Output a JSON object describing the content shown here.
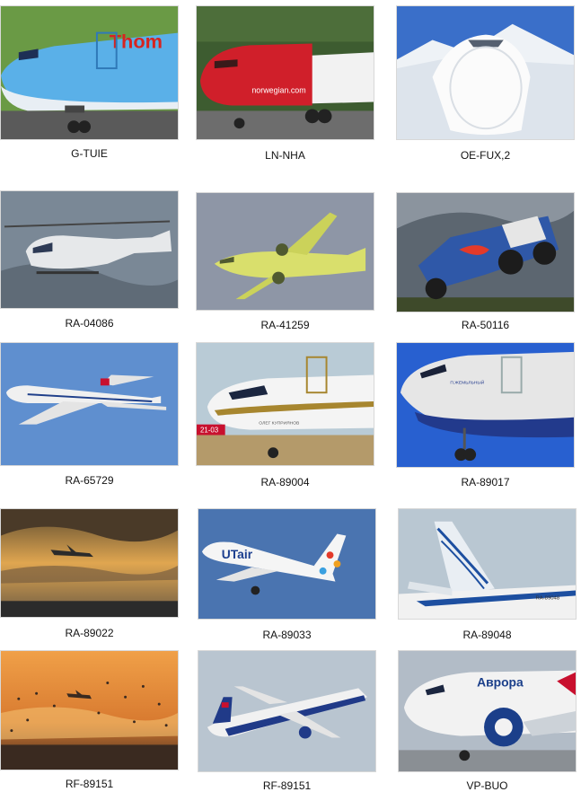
{
  "gallery": {
    "items": [
      {
        "label": "G-TUIE",
        "subject": "boeing-787-airliner",
        "livery_text": "Thom",
        "colors": {
          "sky": "#6a9a45",
          "body": "#5ab0e8",
          "accent": "#d8231f"
        }
      },
      {
        "label": "LN-NHA",
        "subject": "boeing-737-airliner",
        "livery_text": "norwegian.com",
        "colors": {
          "sky": "#3d5c30",
          "body": "#f2f2f2",
          "accent": "#d01f2a"
        }
      },
      {
        "label": "OE-FUX,2",
        "subject": "business-jet-nose-snow",
        "colors": {
          "sky": "#3a6fc9",
          "body": "#eef2f6",
          "accent": "#9aa5b5"
        }
      },
      {
        "label": "RA-04086",
        "subject": "helicopter",
        "colors": {
          "sky": "#7a8896",
          "body": "#e6e8ea",
          "accent": "#2d3a55"
        }
      },
      {
        "label": "RA-41259",
        "subject": "turboprop-primer-yellow",
        "colors": {
          "sky": "#8e96a6",
          "body": "#d9df6c",
          "accent": "#505a30"
        }
      },
      {
        "label": "RA-50116",
        "subject": "rally-truck-jumping",
        "colors": {
          "sky": "#5c6670",
          "body": "#2f58a8",
          "accent": "#e33a2a"
        }
      },
      {
        "label": "RA-65729",
        "subject": "tu-134-airliner",
        "colors": {
          "sky": "#5f8fcf",
          "body": "#f0f0f0",
          "accent": "#1f3f8a"
        }
      },
      {
        "label": "RA-89004",
        "subject": "sukhoi-superjet-gold-trim",
        "livery_text": "ОЛЕГ КУПРИЯНОВ",
        "badge_text": "21-03",
        "colors": {
          "sky": "#b9cbd6",
          "body": "#f4f4f4",
          "accent": "#a7862f"
        }
      },
      {
        "label": "RA-89017",
        "subject": "sukhoi-superjet-aeroflot",
        "livery_text": "П.ЖЕМЬЛЬНЫЙ",
        "colors": {
          "sky": "#2860d0",
          "body": "#e6e6e6",
          "accent": "#223a8c"
        }
      },
      {
        "label": "RA-89022",
        "subject": "aircraft-silhouette-sunset",
        "colors": {
          "sky": "#8a6b3a",
          "body": "#2b2b2b",
          "accent": "#e0a650"
        }
      },
      {
        "label": "RA-89033",
        "subject": "sukhoi-superjet-utair",
        "livery_text": "UTair",
        "colors": {
          "sky": "#4a74b0",
          "body": "#f5f5f5",
          "accent": "#1c3f8f"
        }
      },
      {
        "label": "RA-89048",
        "subject": "tail-fin-gazprom",
        "livery_text": "RA-89048",
        "colors": {
          "sky": "#b9c7d2",
          "body": "#e9eef3",
          "accent": "#1d4fa0"
        }
      },
      {
        "label": "RF-89151",
        "subject": "aircraft-birds-sunset",
        "colors": {
          "sky": "#e08a3a",
          "body": "#3a2a20",
          "accent": "#f3c070"
        }
      },
      {
        "label": "RF-89151",
        "subject": "sukhoi-superjet-state",
        "colors": {
          "sky": "#b9c5d0",
          "body": "#f1f1f1",
          "accent": "#203a88"
        }
      },
      {
        "label": "VP-BUO",
        "subject": "airbus-aurora",
        "livery_text": "Аврора",
        "colors": {
          "sky": "#b2bcc7",
          "body": "#f2f2f2",
          "accent": "#1b3f8a"
        }
      }
    ]
  }
}
